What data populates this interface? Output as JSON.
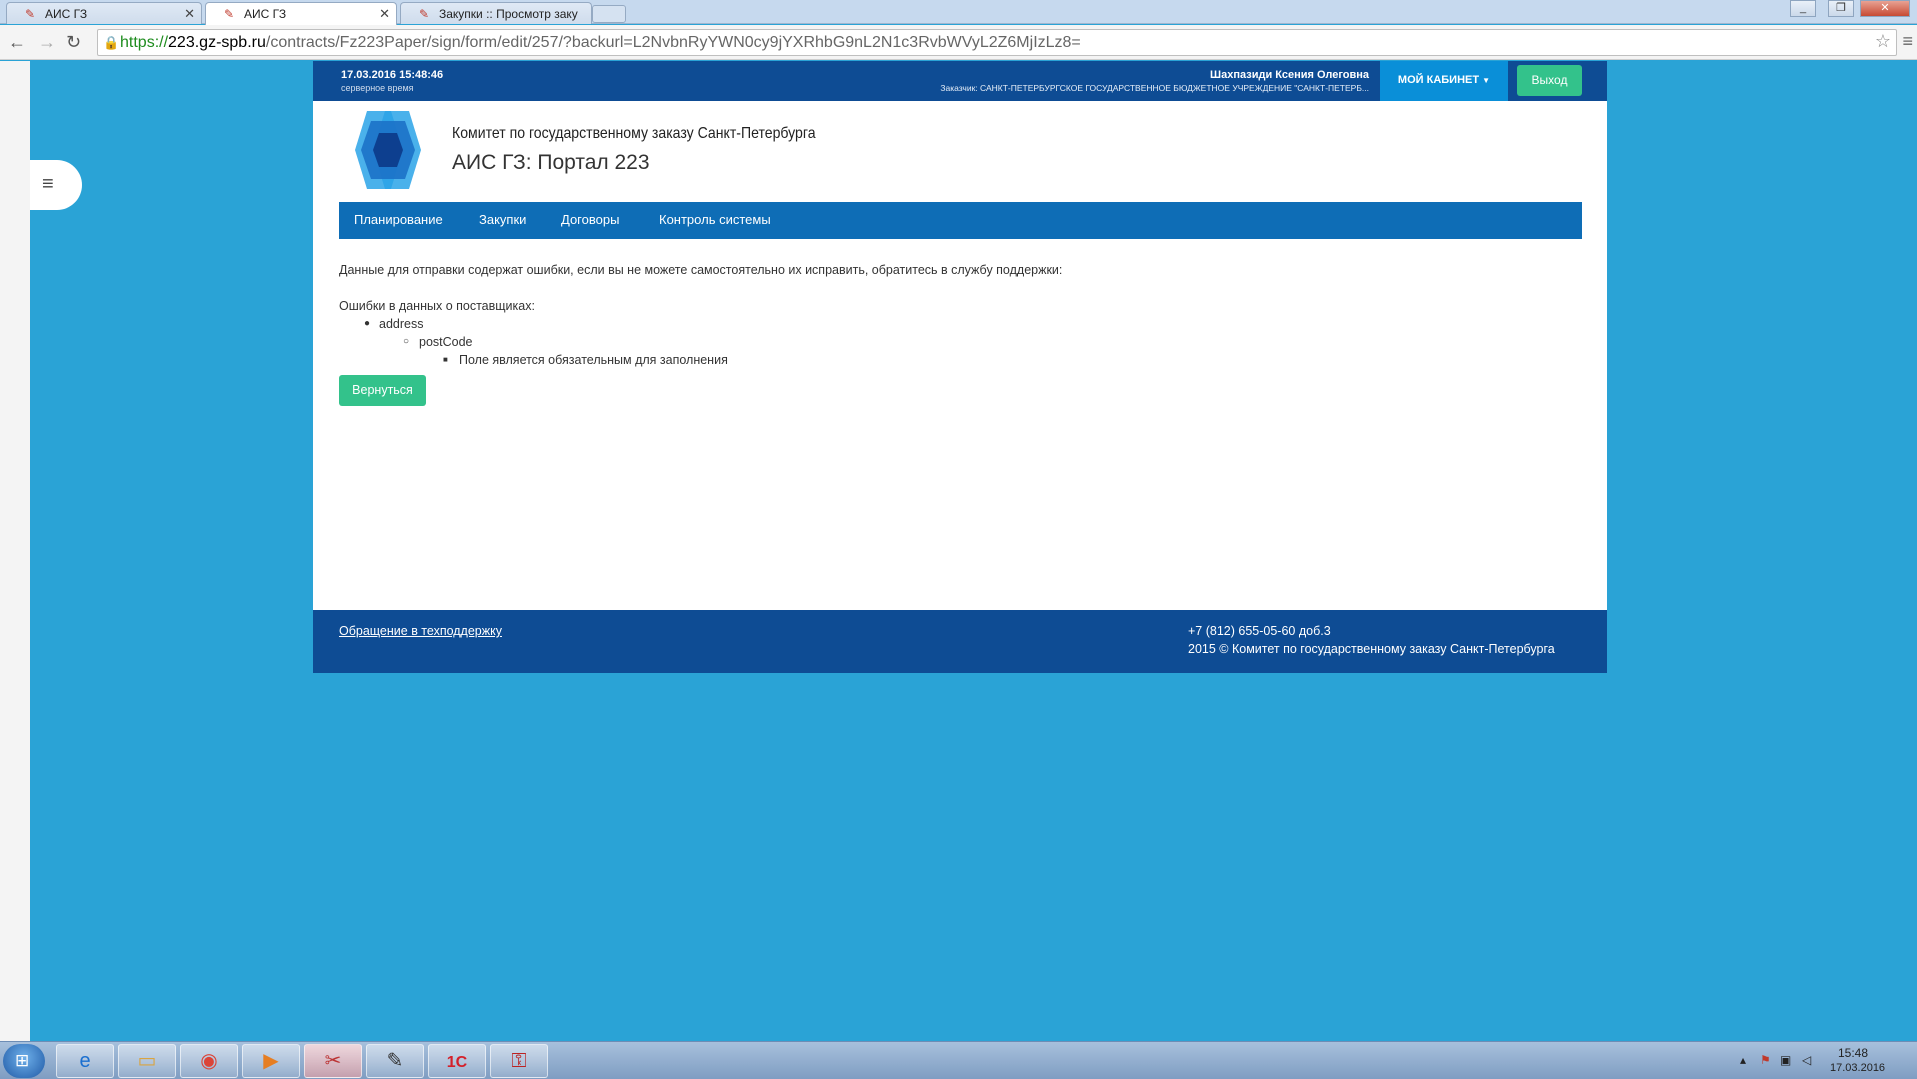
{
  "browser": {
    "tabs": [
      {
        "title": "АИС ГЗ",
        "active": false
      },
      {
        "title": "АИС ГЗ",
        "active": true
      },
      {
        "title": "Закупки :: Просмотр заку",
        "active": false
      }
    ],
    "url_scheme": "https://",
    "url_host": "223.gz-spb.ru",
    "url_path": "/contracts/Fz223Paper/sign/form/edit/257/?backurl=L2NvbnRyYWN0cy9jYXRhbG9nL2N1c3RvbWVyL2Z6MjIzLz8="
  },
  "header": {
    "server_datetime": "17.03.2016 15:48:46",
    "server_label": "серверное время",
    "user_name": "Шахпазиди Ксения Олеговна",
    "customer": "Заказчик: САНКТ-ПЕТЕРБУРГСКОЕ ГОСУДАРСТВЕННОЕ БЮДЖЕТНОЕ УЧРЕЖДЕНИЕ \"САНКТ-ПЕТЕРБ...",
    "cabinet_label": "МОЙ КАБИНЕТ",
    "exit_label": "Выход"
  },
  "brand": {
    "org_title": "Комитет по государственному заказу Санкт-Петербурга",
    "portal_title": "АИС ГЗ: Портал 223"
  },
  "nav": {
    "items": [
      "Планирование",
      "Закупки",
      "Договоры",
      "Контроль системы"
    ]
  },
  "content": {
    "intro": "Данные для отправки содержат ошибки, если вы не можете самостоятельно их исправить, обратитесь в службу поддержки:",
    "errors_heading": "Ошибки в данных о поставщиках:",
    "level1": "address",
    "level2": "postCode",
    "level3": "Поле является обязательным для заполнения",
    "return_label": "Вернуться"
  },
  "footer": {
    "support_link": "Обращение в техподдержку",
    "phone": "+7 (812) 655-05-60 доб.3",
    "copyright": "2015 © Комитет по государственному заказу Санкт-Петербурга"
  },
  "taskbar": {
    "time": "15:48",
    "date": "17.03.2016"
  },
  "colors": {
    "page_bg": "#2aa3d6",
    "header_bg": "#0e4c94",
    "nav_bg": "#0e6db6",
    "cabinet_bg": "#0a8fd8",
    "button_green": "#33c28b"
  }
}
